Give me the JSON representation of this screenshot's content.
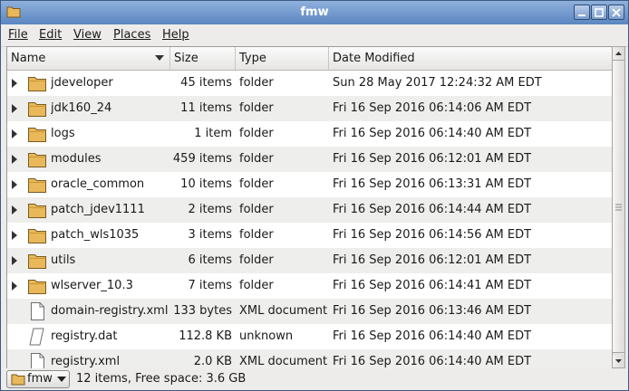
{
  "window": {
    "title": "fmw"
  },
  "menu": [
    {
      "label": "File"
    },
    {
      "label": "Edit"
    },
    {
      "label": "View"
    },
    {
      "label": "Places"
    },
    {
      "label": "Help"
    }
  ],
  "columns": {
    "name": "Name",
    "size": "Size",
    "type": "Type",
    "date": "Date Modified",
    "sorted_by": "Name"
  },
  "rows": [
    {
      "name": "jdeveloper",
      "size": "45 items",
      "type": "folder",
      "date": "Sun 28 May 2017 12:24:32 AM EDT",
      "icon": "folder-icon",
      "expandable": true
    },
    {
      "name": "jdk160_24",
      "size": "11 items",
      "type": "folder",
      "date": "Fri 16 Sep 2016 06:14:06 AM EDT",
      "icon": "folder-icon",
      "expandable": true
    },
    {
      "name": "logs",
      "size": "1 item",
      "type": "folder",
      "date": "Fri 16 Sep 2016 06:14:40 AM EDT",
      "icon": "folder-icon",
      "expandable": true
    },
    {
      "name": "modules",
      "size": "459 items",
      "type": "folder",
      "date": "Fri 16 Sep 2016 06:12:01 AM EDT",
      "icon": "folder-icon",
      "expandable": true
    },
    {
      "name": "oracle_common",
      "size": "10 items",
      "type": "folder",
      "date": "Fri 16 Sep 2016 06:13:31 AM EDT",
      "icon": "folder-icon",
      "expandable": true
    },
    {
      "name": "patch_jdev1111",
      "size": "2 items",
      "type": "folder",
      "date": "Fri 16 Sep 2016 06:14:44 AM EDT",
      "icon": "folder-icon",
      "expandable": true
    },
    {
      "name": "patch_wls1035",
      "size": "3 items",
      "type": "folder",
      "date": "Fri 16 Sep 2016 06:14:56 AM EDT",
      "icon": "folder-icon",
      "expandable": true
    },
    {
      "name": "utils",
      "size": "6 items",
      "type": "folder",
      "date": "Fri 16 Sep 2016 06:12:01 AM EDT",
      "icon": "folder-icon",
      "expandable": true
    },
    {
      "name": "wlserver_10.3",
      "size": "7 items",
      "type": "folder",
      "date": "Fri 16 Sep 2016 06:14:41 AM EDT",
      "icon": "folder-icon",
      "expandable": true
    },
    {
      "name": "domain-registry.xml",
      "size": "133 bytes",
      "type": "XML document",
      "date": "Fri 16 Sep 2016 06:13:46 AM EDT",
      "icon": "document-icon",
      "expandable": false
    },
    {
      "name": "registry.dat",
      "size": "112.8 KB",
      "type": "unknown",
      "date": "Fri 16 Sep 2016 06:14:40 AM EDT",
      "icon": "unknown-file-icon",
      "expandable": false
    },
    {
      "name": "registry.xml",
      "size": "2.0 KB",
      "type": "XML document",
      "date": "Fri 16 Sep 2016 06:14:40 AM EDT",
      "icon": "document-icon",
      "expandable": false
    }
  ],
  "statusbar": {
    "location": "fmw",
    "text": "12 items, Free space: 3.6 GB"
  },
  "colors": {
    "titlebar": "#5b86c1",
    "folder": "#e8b85a",
    "alt_row": "#eeeeec"
  }
}
